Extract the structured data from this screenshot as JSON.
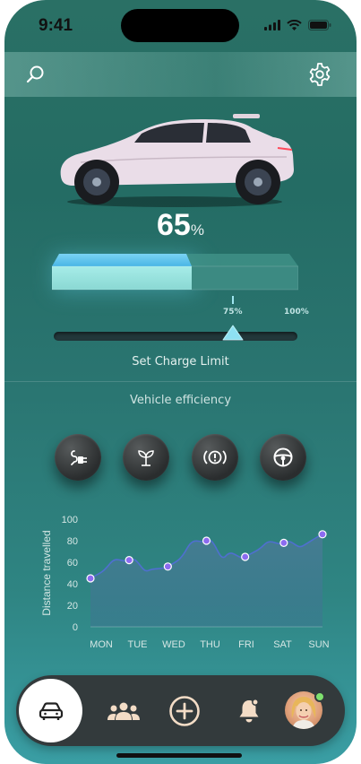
{
  "status_bar": {
    "time": "9:41"
  },
  "header": {
    "search_icon": "search-icon",
    "settings_icon": "gear-icon"
  },
  "charge": {
    "value": "65",
    "unit": "%",
    "fill_fraction": 0.65
  },
  "charge_limit": {
    "marks": [
      "75%",
      "100%"
    ],
    "value_fraction": 0.75,
    "caption": "Set Charge Limit"
  },
  "efficiency": {
    "title": "Vehicle efficiency",
    "buttons": [
      {
        "icon": "charging-plug-icon"
      },
      {
        "icon": "eco-sprout-icon"
      },
      {
        "icon": "brake-warning-icon"
      },
      {
        "icon": "steering-wheel-icon"
      }
    ]
  },
  "chart_data": {
    "type": "area",
    "ylabel": "Distance travelled",
    "xlabel": "",
    "categories": [
      "MON",
      "TUE",
      "WED",
      "THU",
      "FRI",
      "SAT",
      "SUN"
    ],
    "y_ticks": [
      0,
      20,
      40,
      60,
      80,
      100
    ],
    "ylim": [
      0,
      100
    ],
    "series": [
      {
        "values": [
          45,
          62,
          56,
          80,
          65,
          78,
          86
        ]
      }
    ],
    "colors": {
      "line": "#4f6fd0",
      "area": "#3f7188",
      "point": "#8c6bf0"
    },
    "grid": false
  },
  "tabbar": {
    "items": [
      {
        "icon": "car-icon",
        "active": true
      },
      {
        "icon": "group-icon"
      },
      {
        "icon": "add-circle-icon"
      },
      {
        "icon": "notification-bell-icon"
      },
      {
        "icon": "profile-avatar"
      }
    ]
  }
}
